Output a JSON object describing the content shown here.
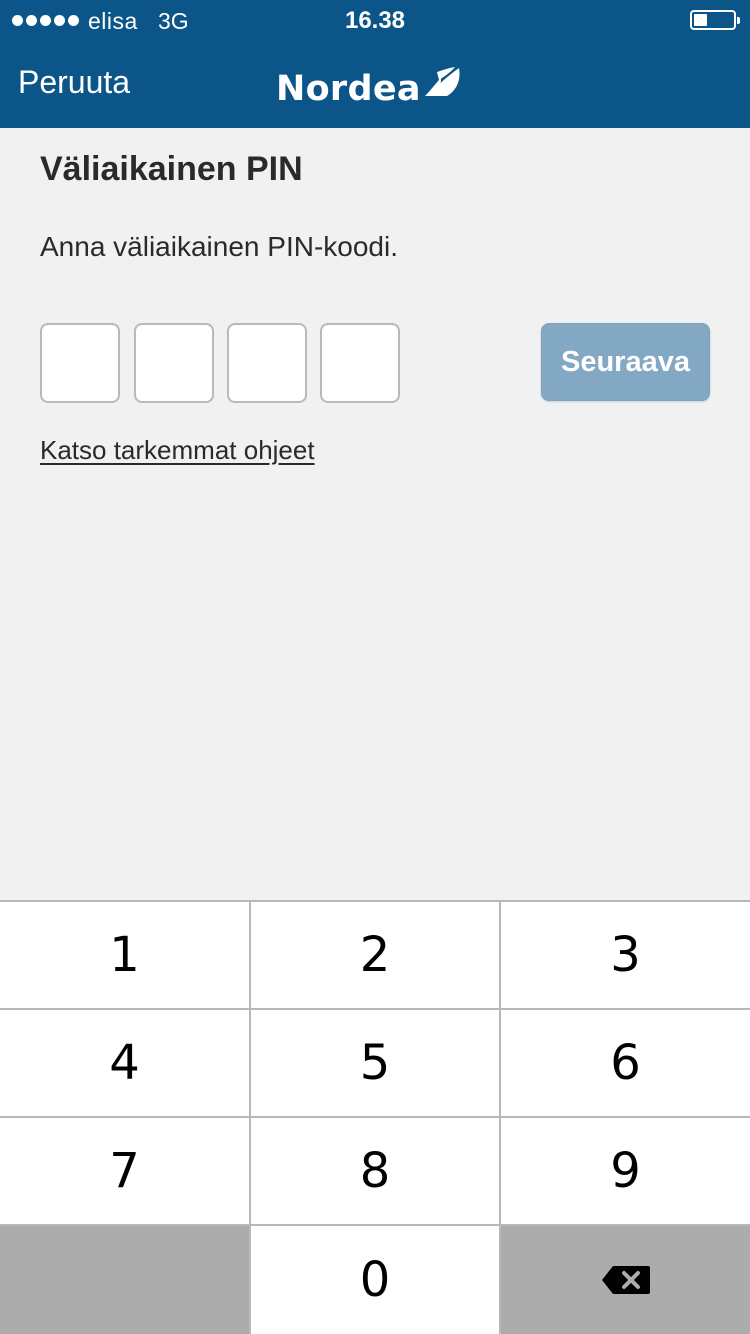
{
  "status_bar": {
    "carrier": "elisa",
    "network": "3G",
    "time": "16.38",
    "signal_bars": 5,
    "battery_level": 0.35
  },
  "nav": {
    "cancel_label": "Peruuta",
    "logo_text": "Nordea"
  },
  "page": {
    "title": "Väliaikainen PIN",
    "instruction": "Anna väliaikainen PIN-koodi.",
    "pin_length": 4,
    "next_button_label": "Seuraava",
    "help_link": "Katso tarkemmat ohjeet"
  },
  "keypad": {
    "keys": [
      "1",
      "2",
      "3",
      "4",
      "5",
      "6",
      "7",
      "8",
      "9",
      "",
      "0",
      "backspace-icon"
    ]
  },
  "colors": {
    "header_bg": "#0b5589",
    "button_disabled": "#82a8c4",
    "page_bg": "#f1f1f1"
  }
}
